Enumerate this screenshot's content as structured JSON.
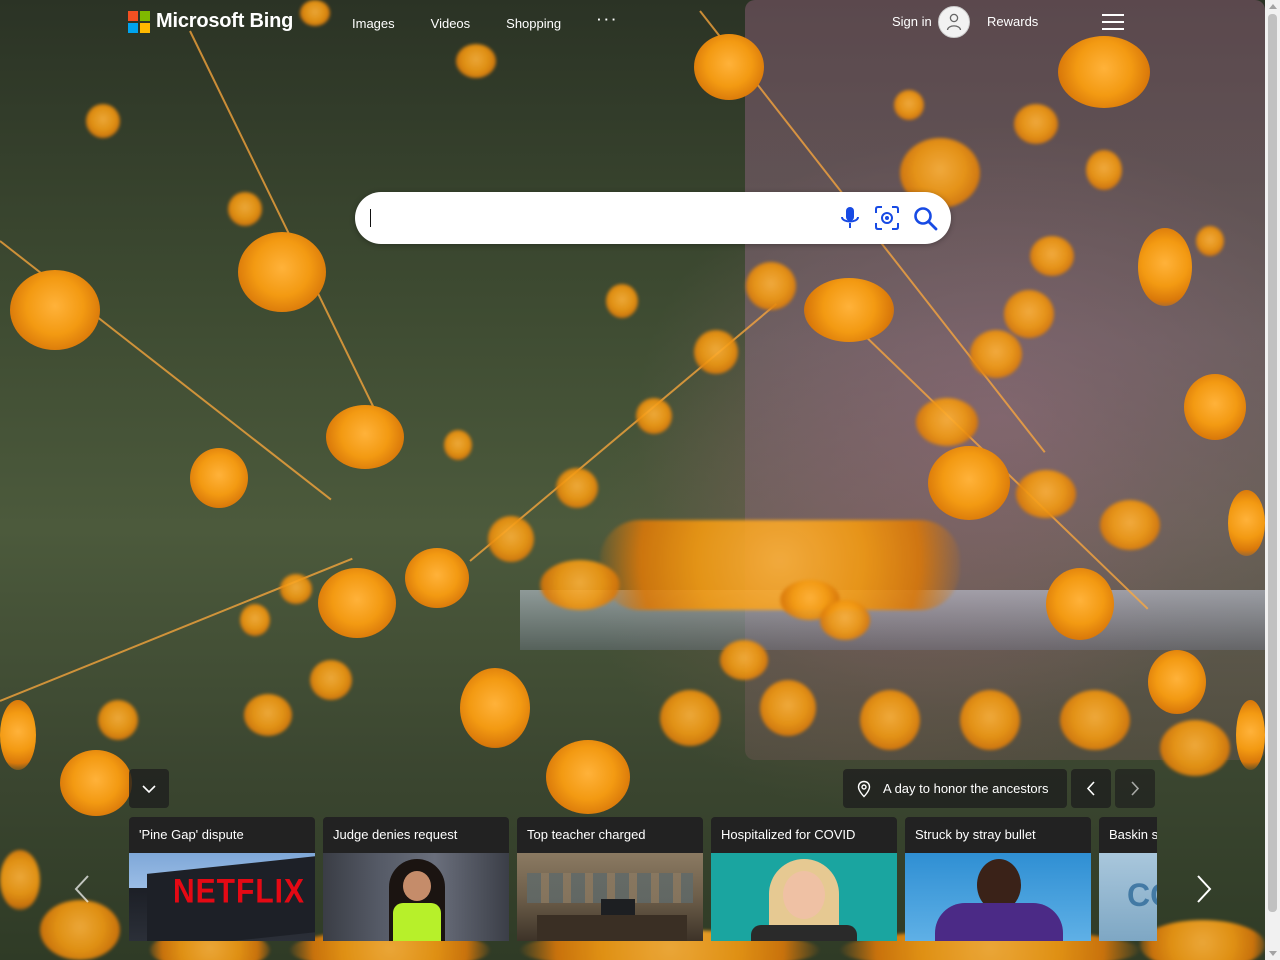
{
  "header": {
    "brand": "Microsoft Bing",
    "nav": [
      {
        "label": "Images"
      },
      {
        "label": "Videos"
      },
      {
        "label": "Shopping"
      },
      {
        "label": "···"
      }
    ],
    "sign_in": "Sign in",
    "rewards": "Rewards"
  },
  "search": {
    "value": "",
    "placeholder": ""
  },
  "image_info": {
    "location_label": "A day to honor the ancestors"
  },
  "news": [
    {
      "title": "'Pine Gap' dispute",
      "thumb": "netflix-building",
      "thumb_text": "NETFLIX"
    },
    {
      "title": "Judge denies request",
      "thumb": "woman-green-top"
    },
    {
      "title": "Top teacher charged",
      "thumb": "courtroom"
    },
    {
      "title": "Hospitalized for COVID",
      "thumb": "blonde-woman-teal-background"
    },
    {
      "title": "Struck by stray bullet",
      "thumb": "football-player"
    },
    {
      "title": "Baskin s",
      "thumb": "blue-logo"
    }
  ],
  "colors": {
    "ms_red": "#f25022",
    "ms_green": "#7fba00",
    "ms_blue": "#00a4ef",
    "ms_yellow": "#ffb900",
    "search_icon": "#174ae4",
    "netflix_red": "#e50914"
  }
}
